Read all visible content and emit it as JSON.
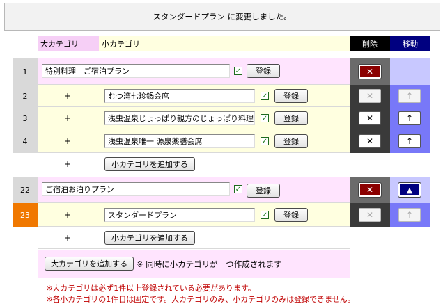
{
  "message": "スタンダードプラン に変更しました。",
  "headers": {
    "large_cat": "大カテゴリ",
    "small_cat": "小カテゴリ",
    "delete": "削除",
    "move": "移動"
  },
  "icons": {
    "delete": "✕",
    "up": "↑",
    "up_triangle": "▲",
    "checkmark": "✓"
  },
  "register_label": "登録",
  "rows": [
    {
      "num": "1",
      "type": "large",
      "name": "特別料理　ご宿泊プラン",
      "checked": true
    },
    {
      "num": "2",
      "type": "small",
      "plus": "+",
      "name": "むつ湾七珍鍋会席",
      "checked": true
    },
    {
      "num": "3",
      "type": "small",
      "plus": "+",
      "name": "浅虫温泉じょっぱり親方のじょっぱり料理",
      "checked": true
    },
    {
      "num": "4",
      "type": "small",
      "plus": "+",
      "name": "浅虫温泉唯一 源泉薬膳会席",
      "checked": true
    },
    {
      "type": "add_small",
      "plus": "+",
      "label": "小カテゴリを追加する"
    },
    {
      "num": "22",
      "type": "large",
      "name": "ご宿泊お泊りプラン",
      "checked": true
    },
    {
      "num": "23",
      "type": "small",
      "plus": "+",
      "name": "スタンダードプラン",
      "checked": true
    },
    {
      "type": "add_small",
      "plus": "+",
      "label": "小カテゴリを追加する"
    }
  ],
  "add_large": {
    "label": "大カテゴリを追加する",
    "note": "※ 同時に小カテゴリが一つ作成されます"
  },
  "notes": [
    "※大カテゴリは必ず1件以上登録されている必要があります。",
    "※各小カテゴリの1件目は固定です。大カテゴリのみ、小カテゴリのみは登録できません。"
  ]
}
